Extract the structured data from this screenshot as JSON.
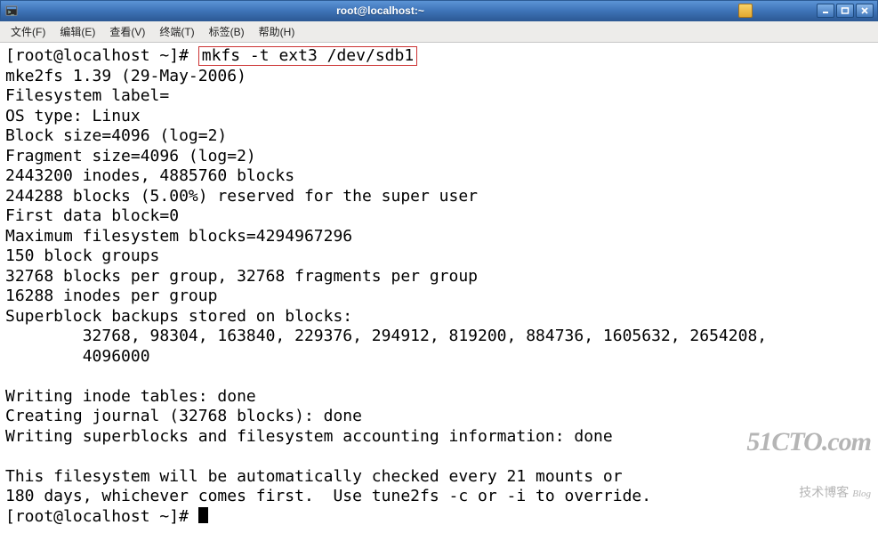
{
  "window": {
    "title": "root@localhost:~"
  },
  "menu": {
    "file": "文件(F)",
    "edit": "编辑(E)",
    "view": "查看(V)",
    "terminal": "终端(T)",
    "tabs": "标签(B)",
    "help": "帮助(H)"
  },
  "term": {
    "prompt1": "[root@localhost ~]# ",
    "cmd_highlight": "mkfs -t ext3 /dev/sdb1",
    "l01": "mke2fs 1.39 (29-May-2006)",
    "l02": "Filesystem label=",
    "l03": "OS type: Linux",
    "l04": "Block size=4096 (log=2)",
    "l05": "Fragment size=4096 (log=2)",
    "l06": "2443200 inodes, 4885760 blocks",
    "l07": "244288 blocks (5.00%) reserved for the super user",
    "l08": "First data block=0",
    "l09": "Maximum filesystem blocks=4294967296",
    "l10": "150 block groups",
    "l11": "32768 blocks per group, 32768 fragments per group",
    "l12": "16288 inodes per group",
    "l13": "Superblock backups stored on blocks:",
    "l14": "        32768, 98304, 163840, 229376, 294912, 819200, 884736, 1605632, 2654208,",
    "l15": "        4096000",
    "l16": "",
    "l17": "Writing inode tables: done",
    "l18": "Creating journal (32768 blocks): done",
    "l19": "Writing superblocks and filesystem accounting information: done",
    "l20": "",
    "l21": "This filesystem will be automatically checked every 21 mounts or",
    "l22": "180 days, whichever comes first.  Use tune2fs -c or -i to override.",
    "prompt2": "[root@localhost ~]# "
  },
  "watermark": {
    "main": "51CTO.com",
    "sub": "技术博客",
    "sub2": "Blog"
  }
}
